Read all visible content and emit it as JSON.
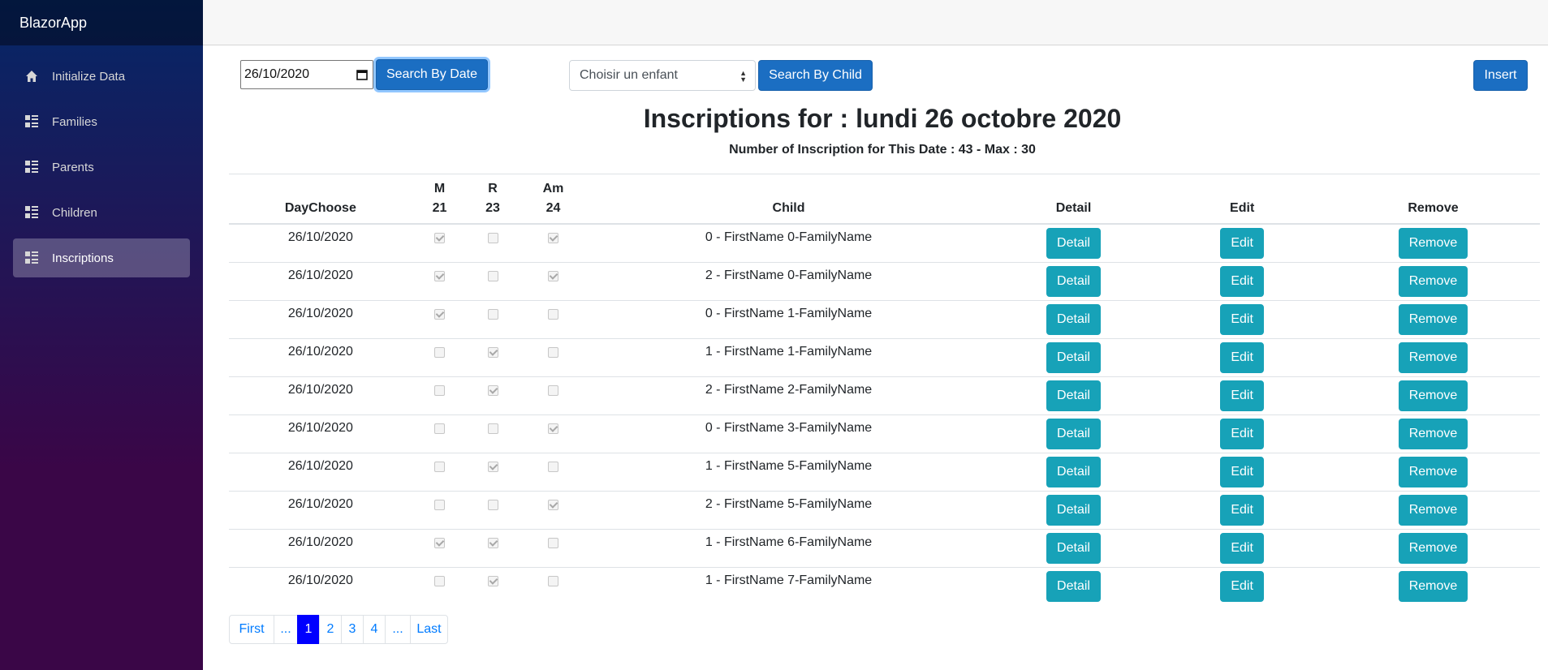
{
  "app": {
    "brand": "BlazorApp"
  },
  "sidebar": {
    "items": [
      {
        "label": "Initialize Data",
        "icon": "home-icon"
      },
      {
        "label": "Families",
        "icon": "list-rich-icon"
      },
      {
        "label": "Parents",
        "icon": "list-rich-icon"
      },
      {
        "label": "Children",
        "icon": "list-rich-icon"
      },
      {
        "label": "Inscriptions",
        "icon": "list-rich-icon",
        "active": true
      }
    ]
  },
  "toolbar": {
    "date_value": "26/10/2020",
    "search_by_date_label": "Search By Date",
    "child_select_value": "Choisir un enfant",
    "search_by_child_label": "Search By Child",
    "insert_label": "Insert"
  },
  "heading": {
    "title": "Inscriptions for : lundi 26 octobre 2020",
    "subtitle": "Number of Inscription for This Date : 43 - Max : 30"
  },
  "table": {
    "headers": {
      "daychoose": "DayChoose",
      "m_top": "M",
      "m_bottom": "21",
      "r_top": "R",
      "r_bottom": "23",
      "am_top": "Am",
      "am_bottom": "24",
      "child": "Child",
      "detail": "Detail",
      "edit": "Edit",
      "remove": "Remove"
    },
    "button_labels": {
      "detail": "Detail",
      "edit": "Edit",
      "remove": "Remove"
    },
    "rows": [
      {
        "date": "26/10/2020",
        "m": true,
        "r": false,
        "am": true,
        "child": "0 - FirstName 0-FamilyName"
      },
      {
        "date": "26/10/2020",
        "m": true,
        "r": false,
        "am": true,
        "child": "2 - FirstName 0-FamilyName"
      },
      {
        "date": "26/10/2020",
        "m": true,
        "r": false,
        "am": false,
        "child": "0 - FirstName 1-FamilyName"
      },
      {
        "date": "26/10/2020",
        "m": false,
        "r": true,
        "am": false,
        "child": "1 - FirstName 1-FamilyName"
      },
      {
        "date": "26/10/2020",
        "m": false,
        "r": true,
        "am": false,
        "child": "2 - FirstName 2-FamilyName"
      },
      {
        "date": "26/10/2020",
        "m": false,
        "r": false,
        "am": true,
        "child": "0 - FirstName 3-FamilyName"
      },
      {
        "date": "26/10/2020",
        "m": false,
        "r": true,
        "am": false,
        "child": "1 - FirstName 5-FamilyName"
      },
      {
        "date": "26/10/2020",
        "m": false,
        "r": false,
        "am": true,
        "child": "2 - FirstName 5-FamilyName"
      },
      {
        "date": "26/10/2020",
        "m": true,
        "r": true,
        "am": false,
        "child": "1 - FirstName 6-FamilyName"
      },
      {
        "date": "26/10/2020",
        "m": false,
        "r": true,
        "am": false,
        "child": "1 - FirstName 7-FamilyName"
      }
    ]
  },
  "pagination": {
    "items": [
      {
        "label": "First"
      },
      {
        "label": "..."
      },
      {
        "label": "1",
        "active": true
      },
      {
        "label": "2"
      },
      {
        "label": "3"
      },
      {
        "label": "4"
      },
      {
        "label": "..."
      },
      {
        "label": "Last"
      }
    ]
  },
  "colors": {
    "primary": "#1b6ec2",
    "info": "#17a2b8",
    "pager_active": "#0000ff"
  }
}
